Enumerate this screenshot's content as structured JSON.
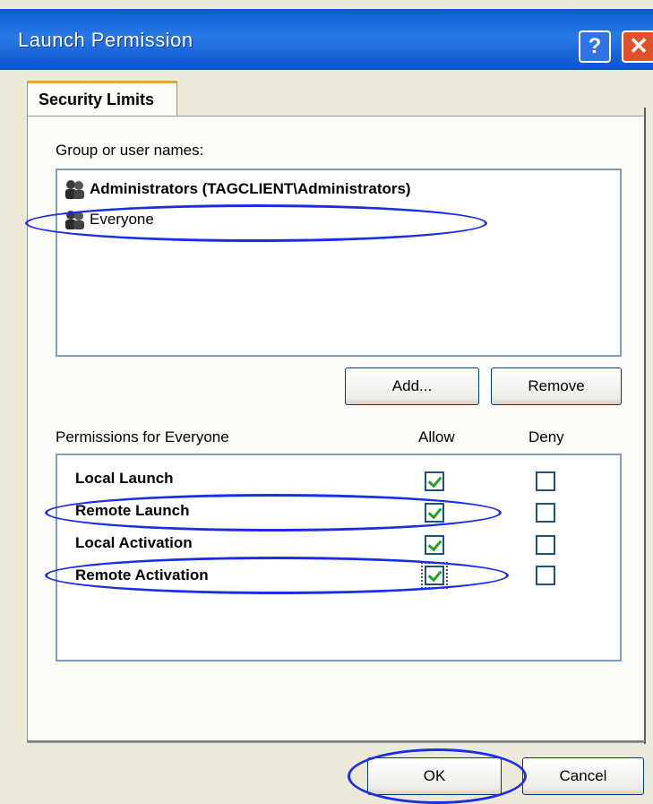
{
  "window": {
    "title": "Launch Permission",
    "help_glyph": "?",
    "close_glyph": "✕"
  },
  "tabs": [
    {
      "label": "Security Limits",
      "active": true
    }
  ],
  "groups": {
    "label": "Group or user names:",
    "items": [
      {
        "label": "Administrators (TAGCLIENT\\Administrators)",
        "icon": "users-icon"
      },
      {
        "label": "Everyone",
        "icon": "users-icon"
      }
    ],
    "add_label": "Add...",
    "remove_label": "Remove"
  },
  "permissions": {
    "label": "Permissions for Everyone",
    "allow_header": "Allow",
    "deny_header": "Deny",
    "rows": [
      {
        "name": "Local Launch",
        "allow": true,
        "deny": false
      },
      {
        "name": "Remote Launch",
        "allow": true,
        "deny": false
      },
      {
        "name": "Local Activation",
        "allow": true,
        "deny": false
      },
      {
        "name": "Remote Activation",
        "allow": true,
        "deny": false
      }
    ]
  },
  "footer": {
    "ok_label": "OK",
    "cancel_label": "Cancel"
  },
  "colors": {
    "annotation": "#1a2fe0",
    "titlebar": "#0a5fd6",
    "dialog_bg": "#ece9d8"
  }
}
